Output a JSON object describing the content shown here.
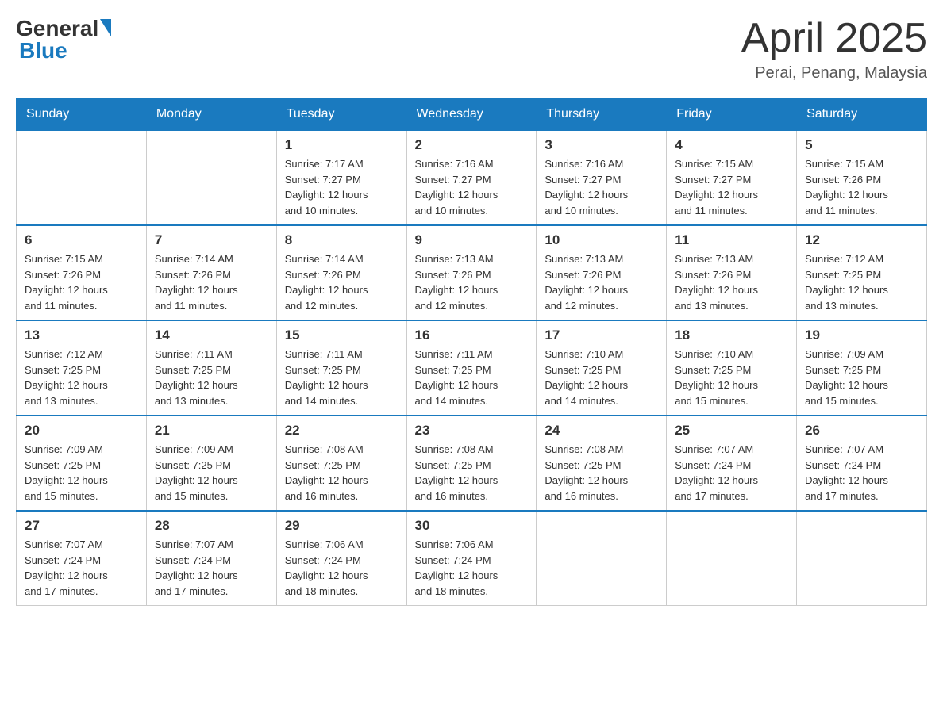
{
  "header": {
    "logo_general": "General",
    "logo_blue": "Blue",
    "title": "April 2025",
    "location": "Perai, Penang, Malaysia"
  },
  "days_of_week": [
    "Sunday",
    "Monday",
    "Tuesday",
    "Wednesday",
    "Thursday",
    "Friday",
    "Saturday"
  ],
  "weeks": [
    [
      {
        "day": "",
        "info": ""
      },
      {
        "day": "",
        "info": ""
      },
      {
        "day": "1",
        "info": "Sunrise: 7:17 AM\nSunset: 7:27 PM\nDaylight: 12 hours\nand 10 minutes."
      },
      {
        "day": "2",
        "info": "Sunrise: 7:16 AM\nSunset: 7:27 PM\nDaylight: 12 hours\nand 10 minutes."
      },
      {
        "day": "3",
        "info": "Sunrise: 7:16 AM\nSunset: 7:27 PM\nDaylight: 12 hours\nand 10 minutes."
      },
      {
        "day": "4",
        "info": "Sunrise: 7:15 AM\nSunset: 7:27 PM\nDaylight: 12 hours\nand 11 minutes."
      },
      {
        "day": "5",
        "info": "Sunrise: 7:15 AM\nSunset: 7:26 PM\nDaylight: 12 hours\nand 11 minutes."
      }
    ],
    [
      {
        "day": "6",
        "info": "Sunrise: 7:15 AM\nSunset: 7:26 PM\nDaylight: 12 hours\nand 11 minutes."
      },
      {
        "day": "7",
        "info": "Sunrise: 7:14 AM\nSunset: 7:26 PM\nDaylight: 12 hours\nand 11 minutes."
      },
      {
        "day": "8",
        "info": "Sunrise: 7:14 AM\nSunset: 7:26 PM\nDaylight: 12 hours\nand 12 minutes."
      },
      {
        "day": "9",
        "info": "Sunrise: 7:13 AM\nSunset: 7:26 PM\nDaylight: 12 hours\nand 12 minutes."
      },
      {
        "day": "10",
        "info": "Sunrise: 7:13 AM\nSunset: 7:26 PM\nDaylight: 12 hours\nand 12 minutes."
      },
      {
        "day": "11",
        "info": "Sunrise: 7:13 AM\nSunset: 7:26 PM\nDaylight: 12 hours\nand 13 minutes."
      },
      {
        "day": "12",
        "info": "Sunrise: 7:12 AM\nSunset: 7:25 PM\nDaylight: 12 hours\nand 13 minutes."
      }
    ],
    [
      {
        "day": "13",
        "info": "Sunrise: 7:12 AM\nSunset: 7:25 PM\nDaylight: 12 hours\nand 13 minutes."
      },
      {
        "day": "14",
        "info": "Sunrise: 7:11 AM\nSunset: 7:25 PM\nDaylight: 12 hours\nand 13 minutes."
      },
      {
        "day": "15",
        "info": "Sunrise: 7:11 AM\nSunset: 7:25 PM\nDaylight: 12 hours\nand 14 minutes."
      },
      {
        "day": "16",
        "info": "Sunrise: 7:11 AM\nSunset: 7:25 PM\nDaylight: 12 hours\nand 14 minutes."
      },
      {
        "day": "17",
        "info": "Sunrise: 7:10 AM\nSunset: 7:25 PM\nDaylight: 12 hours\nand 14 minutes."
      },
      {
        "day": "18",
        "info": "Sunrise: 7:10 AM\nSunset: 7:25 PM\nDaylight: 12 hours\nand 15 minutes."
      },
      {
        "day": "19",
        "info": "Sunrise: 7:09 AM\nSunset: 7:25 PM\nDaylight: 12 hours\nand 15 minutes."
      }
    ],
    [
      {
        "day": "20",
        "info": "Sunrise: 7:09 AM\nSunset: 7:25 PM\nDaylight: 12 hours\nand 15 minutes."
      },
      {
        "day": "21",
        "info": "Sunrise: 7:09 AM\nSunset: 7:25 PM\nDaylight: 12 hours\nand 15 minutes."
      },
      {
        "day": "22",
        "info": "Sunrise: 7:08 AM\nSunset: 7:25 PM\nDaylight: 12 hours\nand 16 minutes."
      },
      {
        "day": "23",
        "info": "Sunrise: 7:08 AM\nSunset: 7:25 PM\nDaylight: 12 hours\nand 16 minutes."
      },
      {
        "day": "24",
        "info": "Sunrise: 7:08 AM\nSunset: 7:25 PM\nDaylight: 12 hours\nand 16 minutes."
      },
      {
        "day": "25",
        "info": "Sunrise: 7:07 AM\nSunset: 7:24 PM\nDaylight: 12 hours\nand 17 minutes."
      },
      {
        "day": "26",
        "info": "Sunrise: 7:07 AM\nSunset: 7:24 PM\nDaylight: 12 hours\nand 17 minutes."
      }
    ],
    [
      {
        "day": "27",
        "info": "Sunrise: 7:07 AM\nSunset: 7:24 PM\nDaylight: 12 hours\nand 17 minutes."
      },
      {
        "day": "28",
        "info": "Sunrise: 7:07 AM\nSunset: 7:24 PM\nDaylight: 12 hours\nand 17 minutes."
      },
      {
        "day": "29",
        "info": "Sunrise: 7:06 AM\nSunset: 7:24 PM\nDaylight: 12 hours\nand 18 minutes."
      },
      {
        "day": "30",
        "info": "Sunrise: 7:06 AM\nSunset: 7:24 PM\nDaylight: 12 hours\nand 18 minutes."
      },
      {
        "day": "",
        "info": ""
      },
      {
        "day": "",
        "info": ""
      },
      {
        "day": "",
        "info": ""
      }
    ]
  ]
}
